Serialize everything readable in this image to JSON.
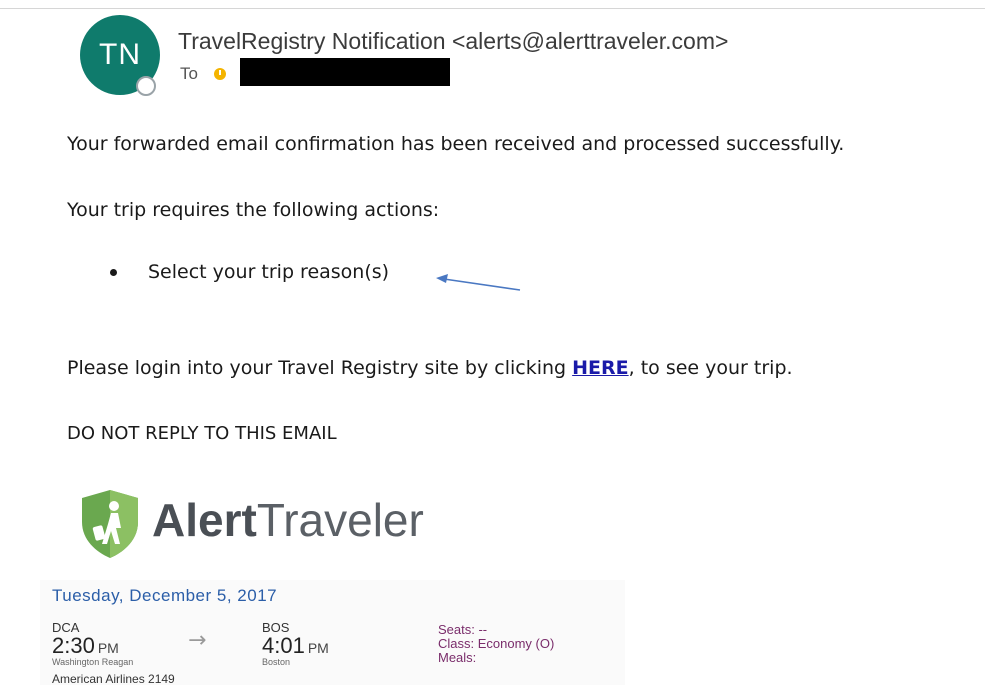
{
  "header": {
    "avatar_initials": "TN",
    "sender": "TravelRegistry Notification <alerts@alerttraveler.com>",
    "to_label": "To"
  },
  "body": {
    "line1": "Your forwarded email confirmation has been received and processed successfully.",
    "line2": "Your trip requires the following actions:",
    "bullets": [
      "Select your trip reason(s)"
    ],
    "login_prefix": "Please login into your Travel Registry site by clicking ",
    "login_link": "HERE",
    "login_suffix": ", to see your trip.",
    "no_reply": "DO NOT REPLY TO THIS EMAIL"
  },
  "logo": {
    "bold": "Alert",
    "light": "Traveler"
  },
  "trip": {
    "date": "Tuesday, December 5, 2017",
    "depart": {
      "code": "DCA",
      "time": "2:30",
      "ampm": "PM",
      "city": "Washington Reagan"
    },
    "arrive": {
      "code": "BOS",
      "time": "4:01",
      "ampm": "PM",
      "city": "Boston"
    },
    "seats": "Seats: --",
    "class": "Class:  Economy (O)",
    "meals": "Meals:",
    "airline": "American Airlines 2149"
  },
  "colors": {
    "avatar": "#0f7b6c",
    "link": "#1a1aa8",
    "date": "#2b5ea8",
    "seat_info": "#7a2d6b",
    "logo_green": "#6aa84f"
  }
}
